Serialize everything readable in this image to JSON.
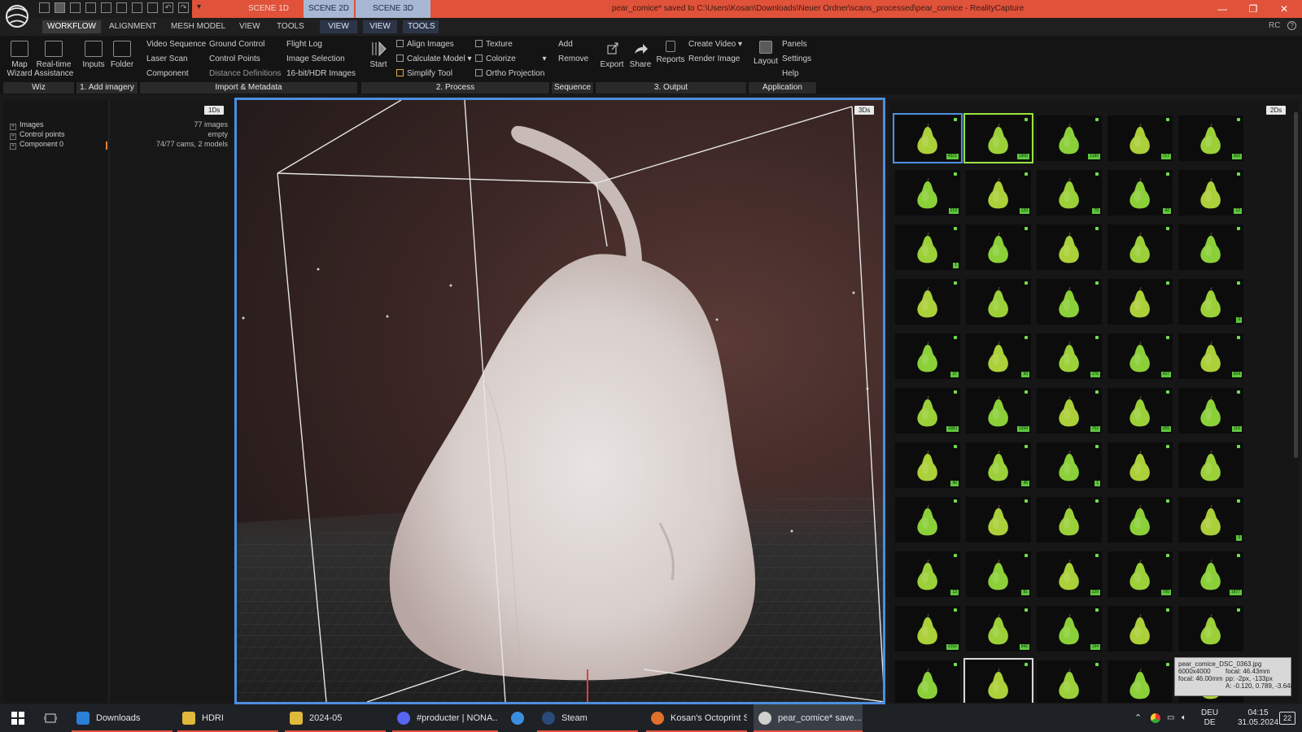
{
  "titlebar": {
    "scene_tabs": [
      "SCENE 1D",
      "SCENE 2D",
      "SCENE 3D"
    ],
    "title": "pear_comice* saved to C:\\Users\\Kosan\\Downloads\\Neuer Ordner\\scans_processed\\pear_comice - RealityCapture",
    "controls": [
      "—",
      "❐",
      "✕"
    ]
  },
  "menu": {
    "items": [
      "WORKFLOW",
      "ALIGNMENT",
      "MESH MODEL",
      "VIEW",
      "TOOLS"
    ],
    "extra": [
      "VIEW",
      "VIEW",
      "TOOLS"
    ],
    "right_rc": "RC",
    "right_help": "?"
  },
  "ribbon": {
    "map_wizard": [
      "Map",
      "Wizard"
    ],
    "realtime": [
      "Real-time",
      "Assistance"
    ],
    "inputs": "Inputs",
    "folder": "Folder",
    "col1": [
      "Video Sequence",
      "Laser Scan",
      "Component"
    ],
    "col2": [
      "Ground Control",
      "Control Points",
      "Distance Definitions"
    ],
    "col3": [
      "Flight Log",
      "Image Selection",
      "16-bit/HDR Images"
    ],
    "start": "Start",
    "col4": [
      "Align Images",
      "Calculate Model",
      "Simplify Tool"
    ],
    "col5": [
      "Texture",
      "Colorize",
      "Ortho Projection"
    ],
    "col6": [
      "Add",
      "Remove"
    ],
    "export": "Export",
    "share": "Share",
    "reports": "Reports",
    "col7": [
      "Create Video",
      "Render Image"
    ],
    "layout": "Layout",
    "col8": [
      "Panels",
      "Settings",
      "Help"
    ],
    "groups": [
      "Wiz",
      "1. Add imagery",
      "Import & Metadata",
      "2. Process",
      "Sequence",
      "3. Output",
      "Application"
    ]
  },
  "left": {
    "tag": "1Ds",
    "rows": [
      "Images",
      "Control points",
      "Component 0"
    ],
    "values": [
      "77 images",
      "empty",
      "74/77 cams, 2 models"
    ]
  },
  "viewport": {
    "tag": "3Ds"
  },
  "right": {
    "tag": "2Ds",
    "counts": [
      [
        "4321",
        "1905",
        "1180",
        "717",
        "363"
      ],
      [
        "219",
        "133",
        "79",
        "42",
        "12"
      ],
      [
        "1",
        "",
        "",
        "",
        ""
      ],
      [
        "",
        "",
        "",
        "",
        "9"
      ],
      [
        "27",
        "99",
        "176",
        "437",
        "924"
      ],
      [
        "1083",
        "1394",
        "752",
        "255",
        "110"
      ],
      [
        "40",
        "46",
        "1",
        "",
        ""
      ],
      [
        "",
        "",
        "",
        "",
        "9"
      ],
      [
        "13",
        "81",
        "229",
        "795",
        "1877"
      ],
      [
        "2152",
        "942",
        "194",
        "",
        ""
      ],
      [
        "",
        "",
        "",
        "",
        ""
      ]
    ]
  },
  "tooltip": {
    "file": "pear_comice_DSC_0363.jpg",
    "res": "6000x4000",
    "focal": "focal: 46.00mm",
    "focal2": "focal: 46.43mm",
    "pp": "pp: -2px, -133px",
    "angles": "A: -0.120, 0.789, -3.648"
  },
  "taskbar": {
    "apps": [
      "Downloads",
      "HDRI",
      "2024-05",
      "#producter | NONA...",
      "",
      "Steam",
      "Kosan's Octoprint S...",
      "pear_comice* save..."
    ],
    "lang": [
      "DEU",
      "DE"
    ],
    "time": "04:15",
    "date": "31.05.2024",
    "notif": "22"
  },
  "colors": {
    "accent_orange": "#e0523a",
    "selection_blue": "#4b8fe0",
    "badge_green": "#5ec63c"
  }
}
